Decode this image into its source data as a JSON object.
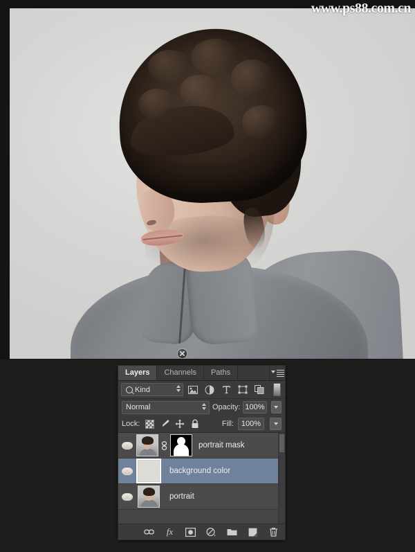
{
  "watermark": {
    "text": "www.ps88.com.cn"
  },
  "canvas": {
    "name": "photoshop-canvas",
    "subject_description": "Portrait of a young man with dark curly hair, three-quarter view, wearing a gray mandarin-collar shirt on a light gray background"
  },
  "panel": {
    "tabs": [
      {
        "label": "Layers",
        "active": true
      },
      {
        "label": "Channels",
        "active": false
      },
      {
        "label": "Paths",
        "active": false
      }
    ],
    "menu_icon": "panel-menu-icon",
    "filter": {
      "kind_label": "Kind",
      "search_icon": "magnifier-icon",
      "icons": [
        "pixel-layers-filter-icon",
        "adjustment-layers-filter-icon",
        "type-layers-filter-icon",
        "shape-layers-filter-icon",
        "smart-object-filter-icon"
      ],
      "toggle": "filter-enable-toggle"
    },
    "blend": {
      "mode": "Normal",
      "opacity_label": "Opacity:",
      "opacity_value": "100%"
    },
    "lock": {
      "label": "Lock:",
      "icons": [
        "lock-transparent-pixels-icon",
        "lock-image-pixels-icon",
        "lock-position-icon",
        "lock-all-icon"
      ],
      "fill_label": "Fill:",
      "fill_value": "100%"
    },
    "layers": [
      {
        "name": "portrait mask",
        "visible": true,
        "selected": false,
        "thumb_type": "portrait",
        "has_link": true,
        "has_mask": true
      },
      {
        "name": "background color",
        "visible": true,
        "selected": true,
        "thumb_type": "solid",
        "has_link": false,
        "has_mask": false
      },
      {
        "name": "portrait",
        "visible": true,
        "selected": false,
        "thumb_type": "portrait",
        "has_link": false,
        "has_mask": false
      }
    ],
    "footer_icons": [
      "link-layers-icon",
      "layer-style-fx-icon",
      "add-layer-mask-icon",
      "new-adjustment-layer-icon",
      "new-group-icon",
      "new-layer-icon",
      "delete-layer-icon"
    ],
    "footer_labels": {
      "fx": "fx"
    },
    "colors": {
      "panel_bg": "#3b3b3b",
      "row_bg": "#4b4b4b",
      "selected_row": "#70819c",
      "text": "#ededed"
    }
  }
}
